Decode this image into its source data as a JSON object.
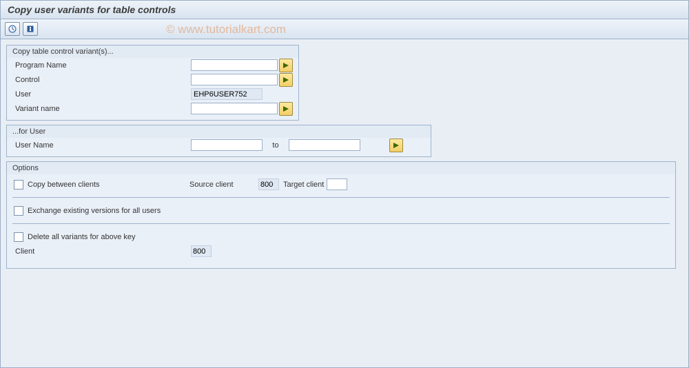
{
  "title": "Copy user variants for table controls",
  "watermark": "© www.tutorialkart.com",
  "group1": {
    "title": "Copy table control variant(s)...",
    "program_name_label": "Program Name",
    "program_name_value": "",
    "control_label": "Control",
    "control_value": "",
    "user_label": "User",
    "user_value": "EHP6USER752",
    "variant_label": "Variant name",
    "variant_value": ""
  },
  "group2": {
    "title": "...for User",
    "user_name_label": "User Name",
    "user_name_value": "",
    "to_label": "to",
    "user_name_to_value": ""
  },
  "group3": {
    "title": "Options",
    "copy_between_clients_label": "Copy between clients",
    "source_client_label": "Source client",
    "source_client_value": "800",
    "target_client_label": "Target client",
    "target_client_value": "",
    "exchange_label": "Exchange existing versions for all users",
    "delete_label": "Delete all variants for above key",
    "client_label": "Client",
    "client_value": "800"
  }
}
